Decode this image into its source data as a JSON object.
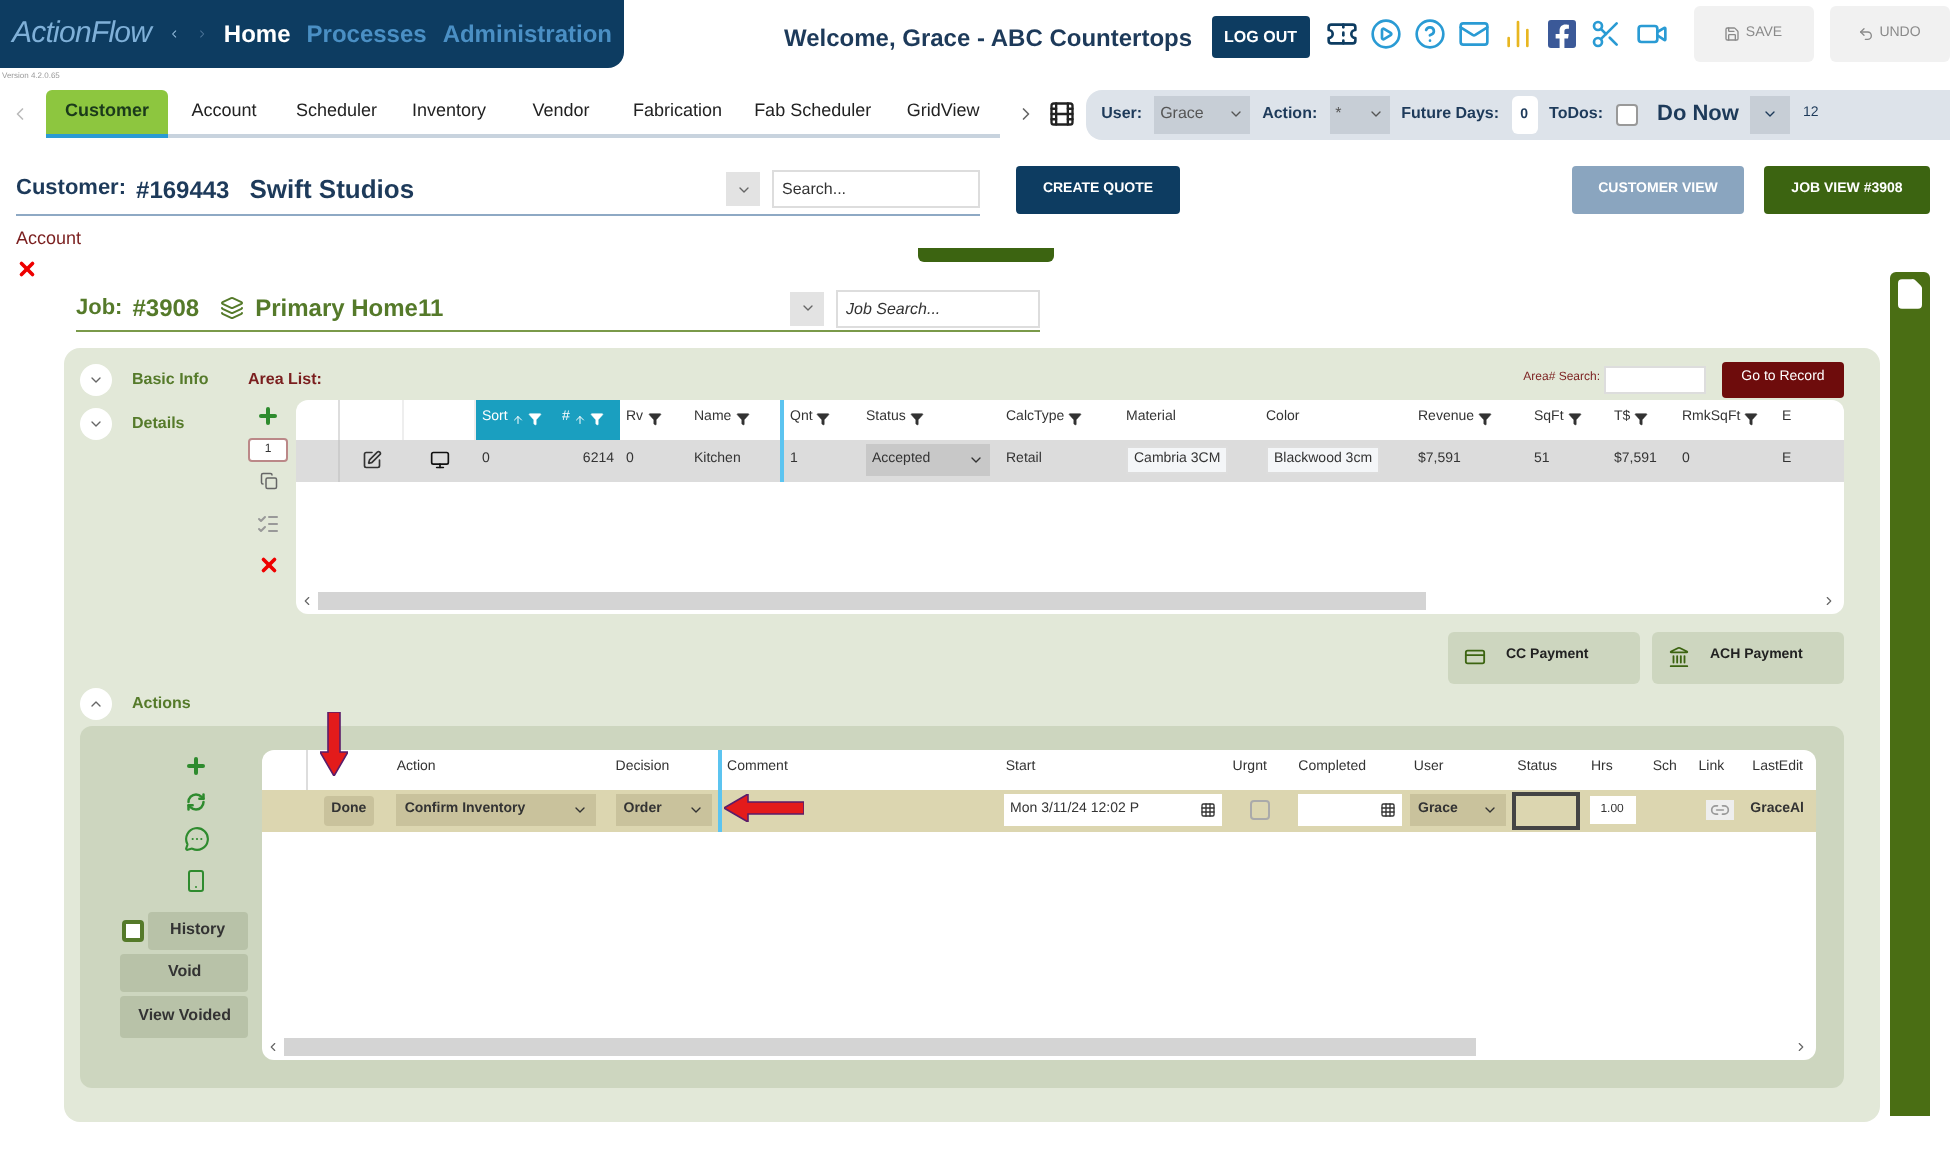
{
  "app": {
    "logo": "ActionFlow",
    "version": "Version 4.2.0.65",
    "nav": [
      {
        "label": "Home",
        "selected": true
      },
      {
        "label": "Processes",
        "selected": false
      },
      {
        "label": "Administration",
        "selected": false
      }
    ]
  },
  "header": {
    "welcome": "Welcome, Grace - ABC Countertops",
    "logout": "LOG OUT",
    "save": {
      "label": "SAVE",
      "disabled": true
    },
    "undo": {
      "label": "UNDO",
      "disabled": true
    }
  },
  "tabs": [
    {
      "label": "Customer",
      "selected": true
    },
    {
      "label": "Account",
      "selected": false
    },
    {
      "label": "Scheduler",
      "selected": false
    },
    {
      "label": "Inventory",
      "selected": false
    },
    {
      "label": "Vendor",
      "selected": false
    },
    {
      "label": "Fabrication",
      "selected": false
    },
    {
      "label": "Fab Scheduler",
      "selected": false
    },
    {
      "label": "GridView",
      "selected": false
    }
  ],
  "filters": {
    "user_label": "User:",
    "user": "Grace",
    "action_label": "Action:",
    "action": "*",
    "future_days_label": "Future Days:",
    "future_days": "0",
    "todos_label": "ToDos:",
    "todos_checked": false,
    "mode": "Do Now",
    "overflow": "12"
  },
  "customer": {
    "label": "Customer:",
    "number": "#169443",
    "name": "Swift Studios",
    "search_placeholder": "Search...",
    "create_quote": "CREATE QUOTE",
    "customer_view": "CUSTOMER VIEW",
    "job_view": "JOB VIEW #3908"
  },
  "account": {
    "label": "Account"
  },
  "job": {
    "label": "Job:",
    "number": "#3908",
    "name": "Primary Home11",
    "search_placeholder": "Job Search..."
  },
  "sections": [
    {
      "label": "Basic Info",
      "expanded": false
    },
    {
      "label": "Details",
      "expanded": false
    }
  ],
  "area_list": {
    "title": "Area List:",
    "search_label": "Area# Search:",
    "go_button": "Go to Record",
    "row_count": "1",
    "columns": [
      {
        "label": "Sort",
        "sorted": true,
        "filter": true,
        "frozen": false
      },
      {
        "label": "#",
        "sorted": true,
        "filter": true,
        "frozen": false
      },
      {
        "label": "Rv",
        "sorted": false,
        "filter": true,
        "frozen": false
      },
      {
        "label": "Name",
        "sorted": false,
        "filter": true,
        "frozen": true
      },
      {
        "label": "Qnt",
        "sorted": false,
        "filter": true,
        "frozen": false
      },
      {
        "label": "Status",
        "sorted": false,
        "filter": true,
        "frozen": false
      },
      {
        "label": "CalcType",
        "sorted": false,
        "filter": true,
        "frozen": false
      },
      {
        "label": "Material",
        "sorted": false,
        "filter": false,
        "frozen": false
      },
      {
        "label": "Color",
        "sorted": false,
        "filter": false,
        "frozen": false
      },
      {
        "label": "Revenue",
        "sorted": false,
        "filter": true,
        "frozen": false
      },
      {
        "label": "SqFt",
        "sorted": false,
        "filter": true,
        "frozen": false
      },
      {
        "label": "T$",
        "sorted": false,
        "filter": true,
        "frozen": false
      },
      {
        "label": "RmkSqFt",
        "sorted": false,
        "filter": true,
        "frozen": false
      },
      {
        "label": "E",
        "sorted": false,
        "filter": false,
        "frozen": false
      }
    ],
    "rows": [
      {
        "cells": [
          {
            "kind": "text",
            "value": "0"
          },
          {
            "kind": "number",
            "value": "6214"
          },
          {
            "kind": "text",
            "value": "0"
          },
          {
            "kind": "text",
            "value": "Kitchen"
          },
          {
            "kind": "text",
            "value": "1"
          },
          {
            "kind": "select",
            "value": "Accepted"
          },
          {
            "kind": "text",
            "value": "Retail"
          },
          {
            "kind": "field",
            "value": "Cambria 3CM"
          },
          {
            "kind": "field",
            "value": "Blackwood 3cm"
          },
          {
            "kind": "text",
            "value": "$7,591"
          },
          {
            "kind": "text",
            "value": "51"
          },
          {
            "kind": "text",
            "value": "$7,591"
          },
          {
            "kind": "text",
            "value": "0"
          },
          {
            "kind": "text",
            "value": "E"
          }
        ]
      }
    ]
  },
  "payments": [
    "CC Payment",
    "ACH Payment"
  ],
  "actions": {
    "label": "Actions",
    "expanded": true,
    "history": {
      "label": "History",
      "checked": false
    },
    "void": "Void",
    "view_voided": "View Voided",
    "columns": [
      {
        "label": "Action",
        "frozen": false
      },
      {
        "label": "Decision",
        "frozen": true
      },
      {
        "label": "Comment",
        "frozen": false
      },
      {
        "label": "Start",
        "frozen": false
      },
      {
        "label": "Urgnt",
        "frozen": false
      },
      {
        "label": "Completed",
        "frozen": false
      },
      {
        "label": "User",
        "frozen": false
      },
      {
        "label": "Status",
        "frozen": false
      },
      {
        "label": "Hrs",
        "frozen": false
      },
      {
        "label": "Sch",
        "frozen": false
      },
      {
        "label": "Link",
        "frozen": false
      },
      {
        "label": "LastEdit",
        "frozen": false
      }
    ],
    "rows": [
      {
        "done": "Done",
        "action": "Confirm Inventory",
        "decision": "Order",
        "start": "Mon 3/11/24 12:02 P",
        "urgent": false,
        "user": "Grace",
        "hours": "1.00",
        "last_edit": "GraceAl"
      }
    ]
  }
}
